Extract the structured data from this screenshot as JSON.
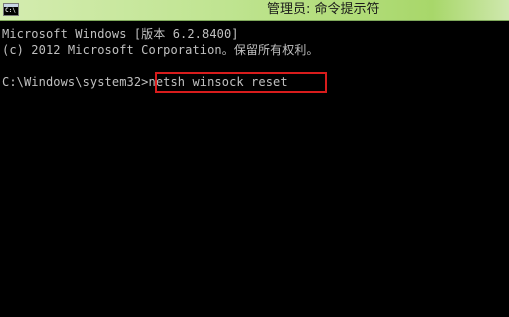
{
  "window": {
    "title": "管理员: 命令提示符",
    "icon": "cmd-icon",
    "icon_glyph": "C:\\"
  },
  "console": {
    "lines": [
      "Microsoft Windows [版本 6.2.8400]",
      "(c) 2012 Microsoft Corporation。保留所有权利。"
    ],
    "prompt": "C:\\Windows\\system32>",
    "command": "netsh winsock reset"
  },
  "colors": {
    "background": "#000000",
    "text": "#c0c0c0",
    "highlight_border": "#d81c1c",
    "titlebar_accent": "#bfe490"
  }
}
